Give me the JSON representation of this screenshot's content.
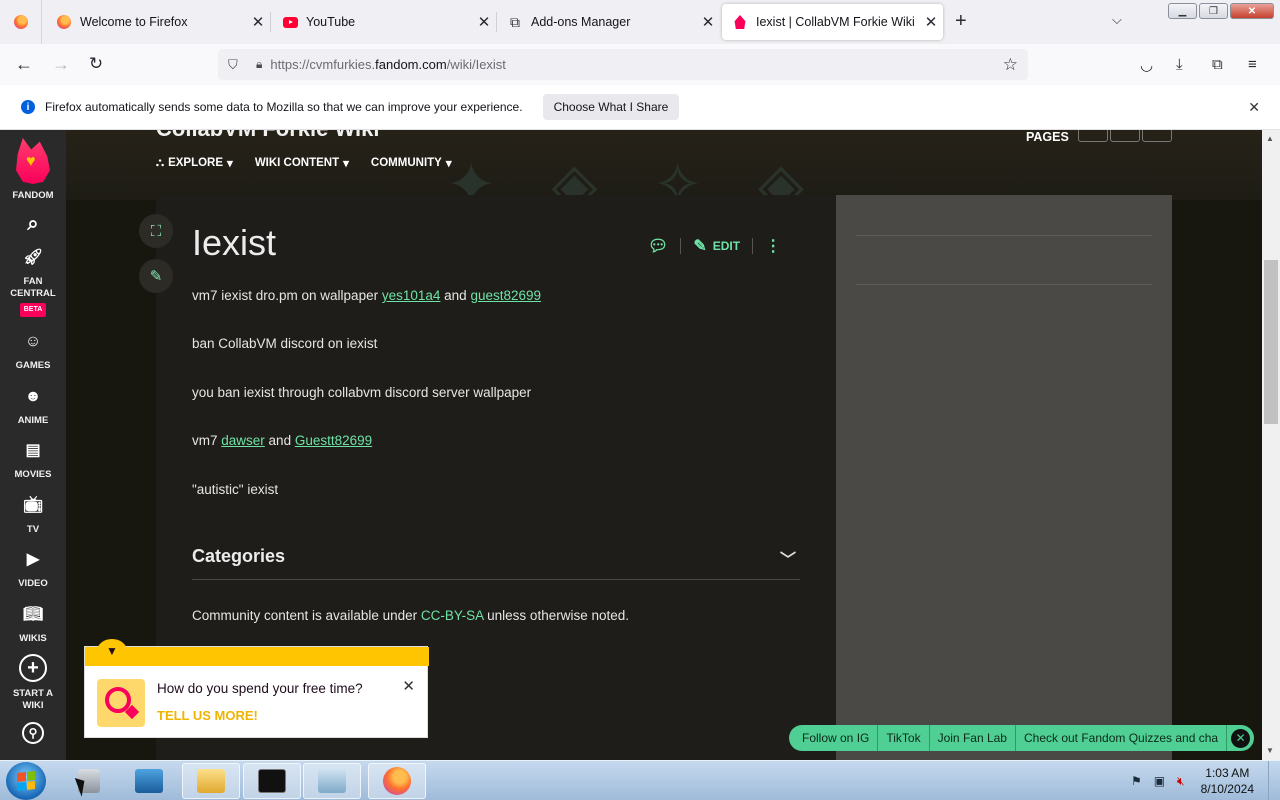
{
  "browser": {
    "tabs": [
      {
        "label": "Welcome to Firefox",
        "icon": "firefox-icon"
      },
      {
        "label": "YouTube",
        "icon": "youtube-icon"
      },
      {
        "label": "Add-ons Manager",
        "icon": "puzzle-icon"
      },
      {
        "label": "Iexist | CollabVM Forkie Wiki | F",
        "icon": "fandom-icon",
        "active": true
      }
    ],
    "url_prefix": "https://cvmfurkies.",
    "url_domain": "fandom.com",
    "url_path": "/wiki/Iexist",
    "info_message": "Firefox automatically sends some data to Mozilla so that we can improve your experience.",
    "info_button": "Choose What I Share"
  },
  "rail": {
    "logo_label": "FANDOM",
    "items": [
      {
        "label": "FAN CENTRAL",
        "badge": "BETA"
      },
      {
        "label": "GAMES"
      },
      {
        "label": "ANIME"
      },
      {
        "label": "MOVIES"
      },
      {
        "label": "TV"
      },
      {
        "label": "VIDEO"
      },
      {
        "label": "WIKIS"
      },
      {
        "label": "START A WIKI"
      }
    ]
  },
  "wiki": {
    "name": "CollabVM Forkie Wiki",
    "nav": [
      "EXPLORE",
      "WIKI CONTENT",
      "COMMUNITY"
    ],
    "pages_label": "PAGES"
  },
  "article": {
    "title": "Iexist",
    "edit_label": "EDIT",
    "p1_text": "vm7 iexist dro.pm on wallpaper ",
    "p1_link1": "yes101a4",
    "p1_and": " and ",
    "p1_link2": "guest82699",
    "p2": "ban CollabVM discord on iexist",
    "p3": "you ban iexist through collabvm discord server wallpaper",
    "p4_text": "vm7 ",
    "p4_link1": "dawser",
    "p4_and": " and ",
    "p4_link2": "Guestt82699",
    "p5": "\"autistic\" iexist",
    "categories_label": "Categories",
    "license_pre": "Community content is available under ",
    "license_link": "CC-BY-SA",
    "license_post": " unless otherwise noted."
  },
  "survey": {
    "question": "How do you spend your free time?",
    "cta": "TELL US MORE!"
  },
  "footer_pills": [
    "Follow on IG",
    "TikTok",
    "Join Fan Lab",
    "Check out Fandom Quizzes and cha"
  ],
  "taskbar": {
    "time": "1:03 AM",
    "date": "8/10/2024"
  },
  "colors": {
    "fandom_pink": "#fa005a",
    "link_green": "#6fe3a5",
    "survey_yellow": "#ffc500"
  }
}
